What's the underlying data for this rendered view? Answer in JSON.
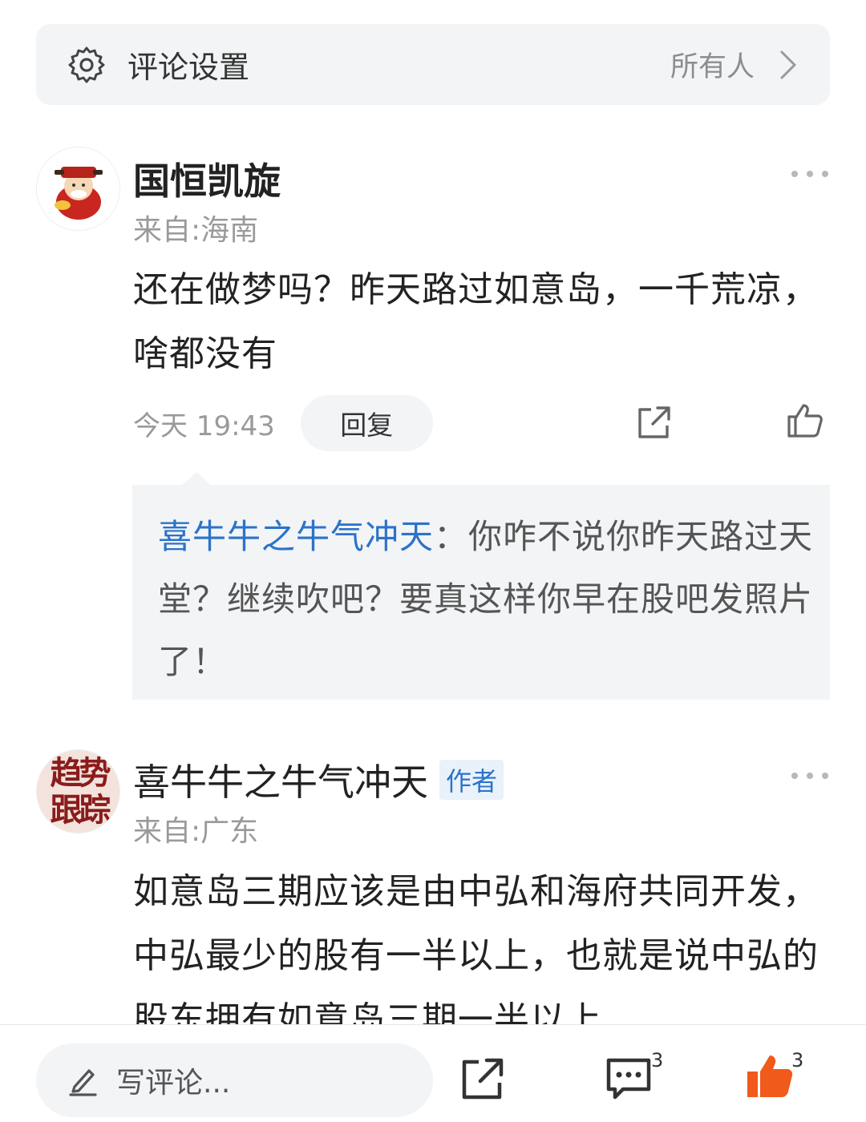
{
  "settings": {
    "title": "评论设置",
    "value": "所有人",
    "icon": "gear-icon"
  },
  "comments": [
    {
      "username": "国恒凯旋",
      "location": "来自:海南",
      "body": "还在做梦吗？昨天路过如意岛，一千荒凉，啥都没有",
      "time": "今天 19:43",
      "reply_label": "回复",
      "nested_reply": {
        "author": "喜牛牛之牛气冲天",
        "text": "：你咋不说你昨天路过天堂？继续吹吧？要真这样你早在股吧发照片了！"
      }
    },
    {
      "username": "喜牛牛之牛气冲天",
      "badge": "作者",
      "location": "来自:广东",
      "body": "如意岛三期应该是由中弘和海府共同开发，中弘最少的股有一半以上，也就是说中弘的股东拥有如意岛三期一半以上",
      "avatar_text": [
        "趋势",
        "跟踪"
      ]
    }
  ],
  "bottom_bar": {
    "placeholder": "写评论...",
    "comment_count": "3",
    "like_count": "3",
    "accent": "#f05a1a"
  }
}
